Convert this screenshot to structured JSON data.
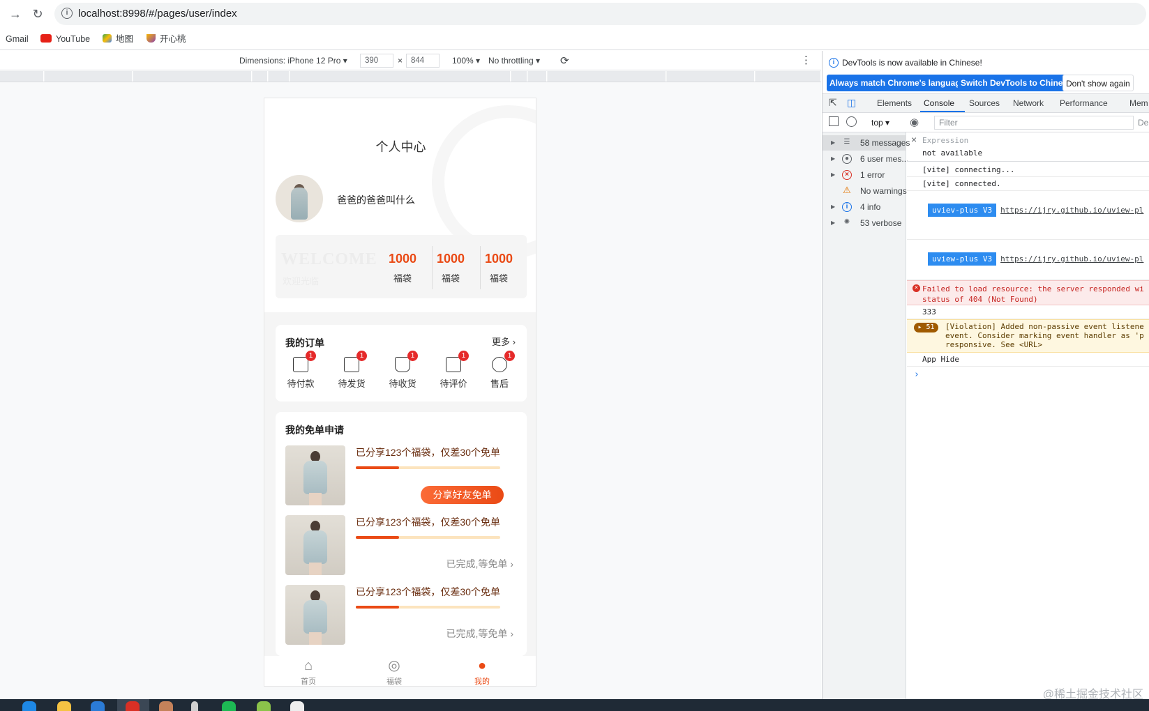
{
  "browser": {
    "url": "localhost:8998/#/pages/user/index",
    "bookmarks": [
      "Gmail",
      "YouTube",
      "地图",
      "开心桃"
    ]
  },
  "device_toolbar": {
    "dimensions": "Dimensions: iPhone 12 Pro",
    "width": "390",
    "height": "844",
    "zoom": "100%",
    "throttling": "No throttling"
  },
  "app": {
    "title": "个人中心",
    "username": "爸爸的爸爸叫什么",
    "welcome": "WELCOME",
    "welcome_sub": "欢迎光临",
    "stats": [
      {
        "value": "1000",
        "label": "福袋"
      },
      {
        "value": "1000",
        "label": "福袋"
      },
      {
        "value": "1000",
        "label": "福袋"
      }
    ],
    "orders": {
      "title": "我的订单",
      "more": "更多",
      "items": [
        {
          "label": "待付款",
          "badge": "1"
        },
        {
          "label": "待发货",
          "badge": "1"
        },
        {
          "label": "待收货",
          "badge": "1"
        },
        {
          "label": "待评价",
          "badge": "1"
        },
        {
          "label": "售后",
          "badge": "1"
        }
      ]
    },
    "free": {
      "title": "我的免单申请",
      "rows": [
        {
          "text": "已分享123个福袋，仅差30个免单",
          "progress": 0.3,
          "action": "分享好友免单"
        },
        {
          "text": "已分享123个福袋，仅差30个免单",
          "progress": 0.3,
          "action": "已完成,等免单"
        },
        {
          "text": "已分享123个福袋，仅差30个免单",
          "progress": 0.3,
          "action": "已完成,等免单"
        }
      ]
    },
    "tabbar": [
      {
        "label": "首页",
        "icon": "home-icon"
      },
      {
        "label": "福袋",
        "icon": "lucky-bag-icon"
      },
      {
        "label": "我的",
        "icon": "user-icon"
      }
    ],
    "accent": "#ea4a15"
  },
  "devtools": {
    "banner": "DevTools is now available in Chinese!",
    "btn_match": "Always match Chrome's language",
    "btn_switch": "Switch DevTools to Chinese",
    "btn_dont": "Don't show again",
    "tabs": [
      "Elements",
      "Console",
      "Sources",
      "Network",
      "Performance",
      "Mem"
    ],
    "context": "top",
    "filter_placeholder": "Filter",
    "filter_right": "De",
    "sidebar": [
      {
        "label": "58 messages",
        "icon": "list-icon"
      },
      {
        "label": "6 user mes...",
        "icon": "user-icon"
      },
      {
        "label": "1 error",
        "icon": "error-icon"
      },
      {
        "label": "No warnings",
        "icon": "warning-icon"
      },
      {
        "label": "4 info",
        "icon": "info-icon"
      },
      {
        "label": "53 verbose",
        "icon": "bug-icon"
      }
    ],
    "expression_label": "Expression",
    "expression_value": "not available",
    "console": [
      "[vite] connecting...",
      "[vite] connected.",
      "uviev-plus V3",
      "https://ijry.github.io/uview-pl",
      "uview-plus V3",
      "https://ijry.github.io/uview-pl",
      "Failed to load resource: the server responded wi",
      "status of 404 (Not Found)",
      "333",
      "51",
      "[Violation] Added non-passive event listene",
      "event. Consider marking event handler as 'p",
      "responsive. See <URL>",
      "App Hide"
    ],
    "watermark": "@稀土掘金技术社区"
  }
}
